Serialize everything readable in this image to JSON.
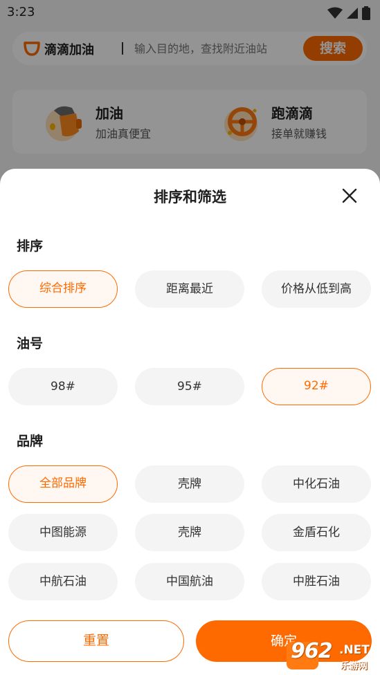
{
  "status_bar": {
    "time": "3:23",
    "icons": [
      "wifi-icon",
      "cellular-signal-icon",
      "battery-icon"
    ]
  },
  "search": {
    "brand": "滴滴加油",
    "placeholder": "输入目的地，查找附近油站",
    "button_label": "搜索"
  },
  "services": [
    {
      "title": "加油",
      "subtitle": "加油真便宜",
      "icon": "fuel-nozzle-icon"
    },
    {
      "title": "跑滴滴",
      "subtitle": "接单就赚钱",
      "icon": "steering-wheel-icon"
    }
  ],
  "sheet": {
    "title": "排序和筛选",
    "close_icon": "close-icon",
    "sort": {
      "label": "排序",
      "options": [
        {
          "label": "综合排序",
          "selected": true
        },
        {
          "label": "距离最近",
          "selected": false
        },
        {
          "label": "价格从低到高",
          "selected": false
        }
      ]
    },
    "fuel": {
      "label": "油号",
      "options": [
        {
          "label": "98#",
          "selected": false
        },
        {
          "label": "95#",
          "selected": false
        },
        {
          "label": "92#",
          "selected": true
        }
      ]
    },
    "brand": {
      "label": "品牌",
      "options": [
        {
          "label": "全部品牌",
          "selected": true
        },
        {
          "label": "壳牌",
          "selected": false
        },
        {
          "label": "中化石油",
          "selected": false
        },
        {
          "label": "中图能源",
          "selected": false
        },
        {
          "label": "壳牌",
          "selected": false
        },
        {
          "label": "金盾石化",
          "selected": false
        },
        {
          "label": "中航石油",
          "selected": false
        },
        {
          "label": "中国航油",
          "selected": false
        },
        {
          "label": "中胜石油",
          "selected": false
        }
      ]
    },
    "reset_label": "重置",
    "confirm_label": "确定"
  },
  "watermark": {
    "number": "962",
    "net": ".NET",
    "sub": "乐游网"
  },
  "colors": {
    "accent": "#ff6a00",
    "chip_bg": "#f4f4f4",
    "selected_chip_bg": "#fff7f1",
    "overlay": "rgba(0,0,0,0.42)"
  }
}
